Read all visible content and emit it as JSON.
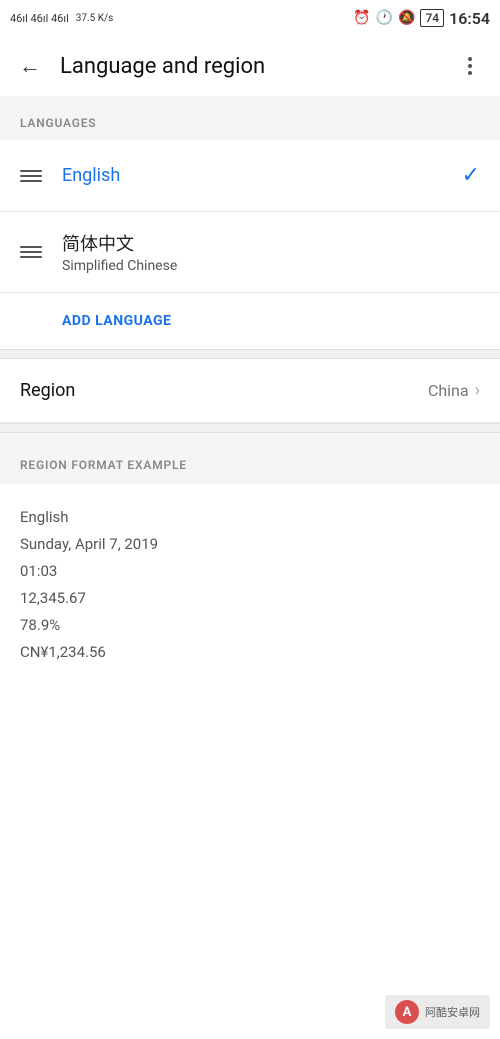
{
  "statusBar": {
    "signalLeft": "46ıl 46ıl 46ıl",
    "networkSpeed": "37.5 K/s",
    "time": "16:54",
    "battery": "74"
  },
  "appBar": {
    "title": "Language and region",
    "backLabel": "←",
    "moreLabel": "⋮"
  },
  "sections": {
    "languagesHeader": "LANGUAGES",
    "regionLabel": "Region",
    "regionValue": "China",
    "regionFormatHeader": "REGION FORMAT EXAMPLE",
    "addLanguageLabel": "ADD LANGUAGE"
  },
  "languages": [
    {
      "name": "English",
      "subtitle": "",
      "isSelected": true
    },
    {
      "name": "简体中文",
      "subtitle": "Simplified Chinese",
      "isSelected": false
    }
  ],
  "regionFormat": {
    "locale": "English",
    "date": "Sunday, April 7, 2019",
    "time": "01:03",
    "number": "12,345.67",
    "percent": "78.9%",
    "currency": "CN¥1,234.56"
  },
  "watermark": {
    "text": "阿酷安卓网"
  }
}
